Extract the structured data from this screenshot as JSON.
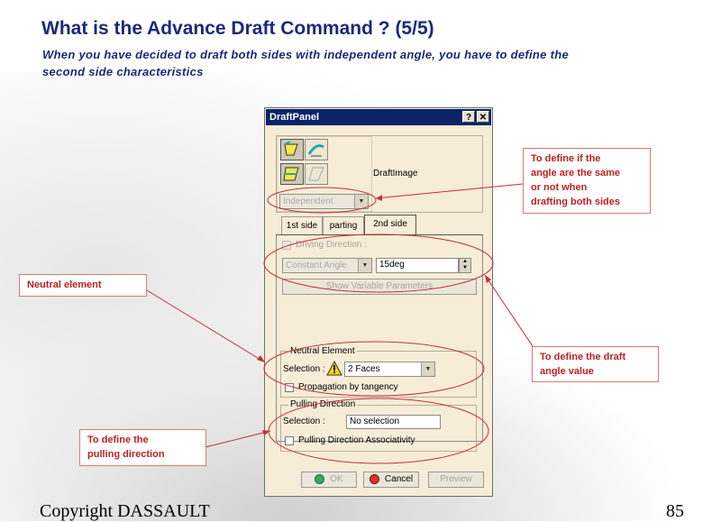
{
  "slide": {
    "title": "What is the Advance Draft Command ? (5/5)",
    "subtitle_line1": "When you have decided to draft both sides with independent angle, you have to define the",
    "subtitle_line2": "second side characteristics",
    "footer_left": "Copyright DASSAULT",
    "page_number": "85"
  },
  "dialog": {
    "title": "DraftPanel",
    "help_btn": "?",
    "close_btn": "✕",
    "image_label": "DraftImage",
    "mode_select": "Independent",
    "tabs": [
      "1st side",
      "parting",
      "2nd side"
    ],
    "driving_direction": "Driving Direction :",
    "angle_type": "Constant Angle",
    "angle_value": "15deg",
    "show_variable_params": "Show Variable Parameters",
    "neutral_element_group": "Neutral Element",
    "neutral_selection_label": "Selection :",
    "neutral_selection_value": "2 Faces",
    "propagation": "Propagation by tangency",
    "pulling_direction_group": "Pulling Direction",
    "pulling_selection_label": "Selection :",
    "pulling_selection_value": "No selection",
    "pulling_assoc": "Pulling Direction Associativity",
    "ok": "OK",
    "cancel": "Cancel",
    "preview": "Preview"
  },
  "callouts": {
    "same_angle_l1": "To define if the",
    "same_angle_l2": "angle are the same",
    "same_angle_l3": "or not when",
    "same_angle_l4": "drafting both sides",
    "neutral": "Neutral element",
    "draft_angle_l1": "To define the draft",
    "draft_angle_l2": "angle value",
    "pulling_l1": "To define the",
    "pulling_l2": "pulling direction"
  },
  "colors": {
    "title": "#1a2a7a",
    "callout_text": "#b22222",
    "annotation": "#c0303a",
    "dialog_bg": "#f7ecd6",
    "titlebar": "#0b2466"
  }
}
